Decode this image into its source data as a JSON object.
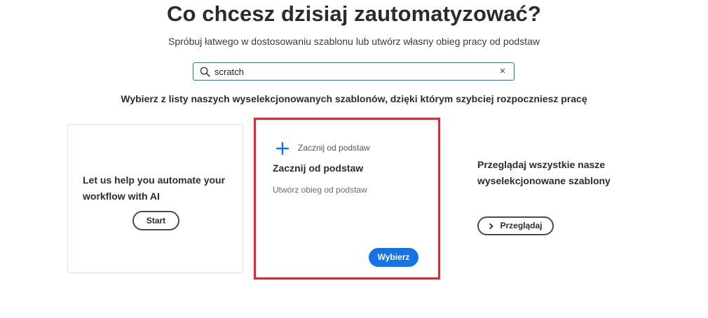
{
  "header": {
    "title": "Co chcesz dzisiaj zautomatyzować?",
    "subtitle": "Spróbuj łatwego w dostosowaniu szablonu lub utwórz własny obieg pracy od podstaw"
  },
  "search": {
    "value": "scratch",
    "clear_glyph": "×",
    "icon": "search-icon"
  },
  "section_heading": "Wybierz z listy naszych wyselekcjonowanych szablonów, dzięki którym szybciej rozpoczniesz pracę",
  "ai_card": {
    "text": "Let us help you automate your workflow with AI",
    "button_label": "Start"
  },
  "template_card": {
    "icon": "plus-icon",
    "kind_label": "Zacznij od podstaw",
    "title": "Zacznij od podstaw",
    "description": "Utwórz obieg od podstaw",
    "button_label": "Wybierz"
  },
  "browse": {
    "text": "Przeglądaj wszystkie nasze wyselekcjonowane szablony",
    "button_label": "Przeglądaj",
    "icon": "chevron-right-icon"
  },
  "colors": {
    "accent": "#1473e6",
    "highlight_border": "#e3262f",
    "text": "#2c2c2c"
  }
}
